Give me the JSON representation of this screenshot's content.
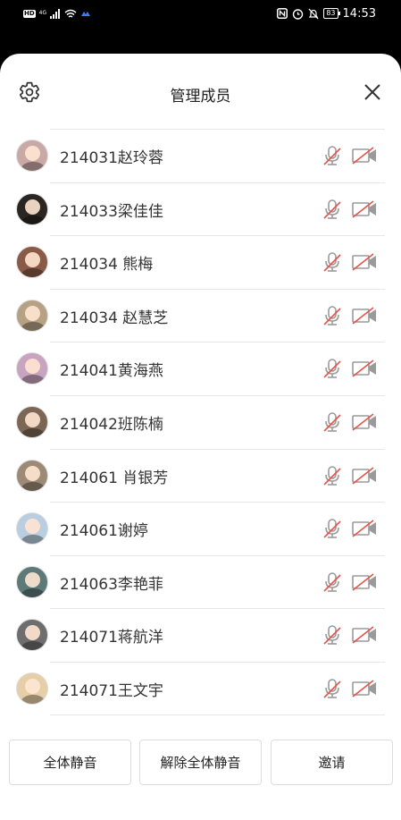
{
  "status_bar": {
    "hd": "HD",
    "network": "4G",
    "battery": "83",
    "time": "14:53"
  },
  "header": {
    "title": "管理成员",
    "settings_icon": "gear-icon",
    "close_icon": "close-icon"
  },
  "members": [
    {
      "name": "214031赵玲蓉",
      "avatar_color": "#c9a9a6",
      "mic": "muted",
      "camera": "off"
    },
    {
      "name": "214033梁佳佳",
      "avatar_color": "#2b2622",
      "mic": "muted",
      "camera": "off"
    },
    {
      "name": "214034 熊梅",
      "avatar_color": "#8a5a48",
      "mic": "muted",
      "camera": "off"
    },
    {
      "name": "214034 赵慧芝",
      "avatar_color": "#b6a184",
      "mic": "muted",
      "camera": "off"
    },
    {
      "name": "214041黄海燕",
      "avatar_color": "#c9a4c0",
      "mic": "muted",
      "camera": "off"
    },
    {
      "name": "214042班陈楠",
      "avatar_color": "#7c6655",
      "mic": "muted",
      "camera": "off"
    },
    {
      "name": "214061 肖银芳",
      "avatar_color": "#9c8a76",
      "mic": "muted",
      "camera": "off"
    },
    {
      "name": "214061谢婷",
      "avatar_color": "#b9cee0",
      "mic": "muted",
      "camera": "off"
    },
    {
      "name": "214063李艳菲",
      "avatar_color": "#5d7a78",
      "mic": "muted",
      "camera": "off"
    },
    {
      "name": "214071蒋航洋",
      "avatar_color": "#6e6e6e",
      "mic": "muted",
      "camera": "off"
    },
    {
      "name": "214071王文宇",
      "avatar_color": "#e6cfa8",
      "mic": "muted",
      "camera": "off"
    }
  ],
  "actions": {
    "mute_all": "全体静音",
    "unmute_all": "解除全体静音",
    "invite": "邀请"
  },
  "colors": {
    "muted_red": "#e5534b",
    "icon_gray": "#9a9a9a",
    "text": "#333333"
  }
}
